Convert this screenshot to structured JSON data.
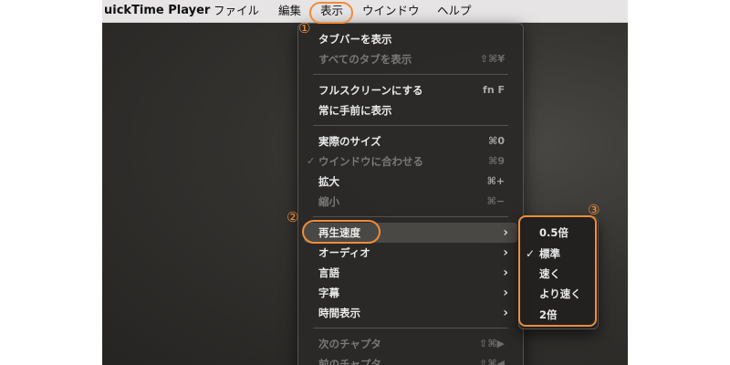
{
  "menubar": {
    "app_name": "uickTime Player",
    "items": [
      "ファイル",
      "編集",
      "表示",
      "ウインドウ",
      "ヘルプ"
    ]
  },
  "view_menu": {
    "show_tab_bar": "タブバーを表示",
    "show_all_tabs": "すべてのタブを表示",
    "show_all_tabs_shortcut": "⇧⌘¥",
    "fullscreen": "フルスクリーンにする",
    "fullscreen_shortcut": "fn F",
    "always_on_top": "常に手前に表示",
    "actual_size": "実際のサイズ",
    "actual_size_shortcut": "⌘0",
    "fit_window_check": "✓",
    "fit_window": "ウインドウに合わせる",
    "fit_window_shortcut": "⌘9",
    "zoom_in": "拡大",
    "zoom_in_shortcut": "⌘+",
    "zoom_out": "縮小",
    "zoom_out_shortcut": "⌘−",
    "playback_speed": "再生速度",
    "audio": "オーディオ",
    "language": "言語",
    "subtitles": "字幕",
    "time_display": "時間表示",
    "next_chapter": "次のチャプタ",
    "next_chapter_shortcut": "⇧⌘▶",
    "prev_chapter": "前のチャプタ",
    "prev_chapter_shortcut": "⇧⌘◀",
    "chevron": "›"
  },
  "speed_submenu": {
    "items": [
      "0.5倍",
      "標準",
      "速く",
      "より速く",
      "2倍"
    ],
    "check": "✓"
  },
  "annotations": {
    "badge1": "①",
    "badge2": "②",
    "badge3": "③",
    "color": "#ef8c3a"
  }
}
